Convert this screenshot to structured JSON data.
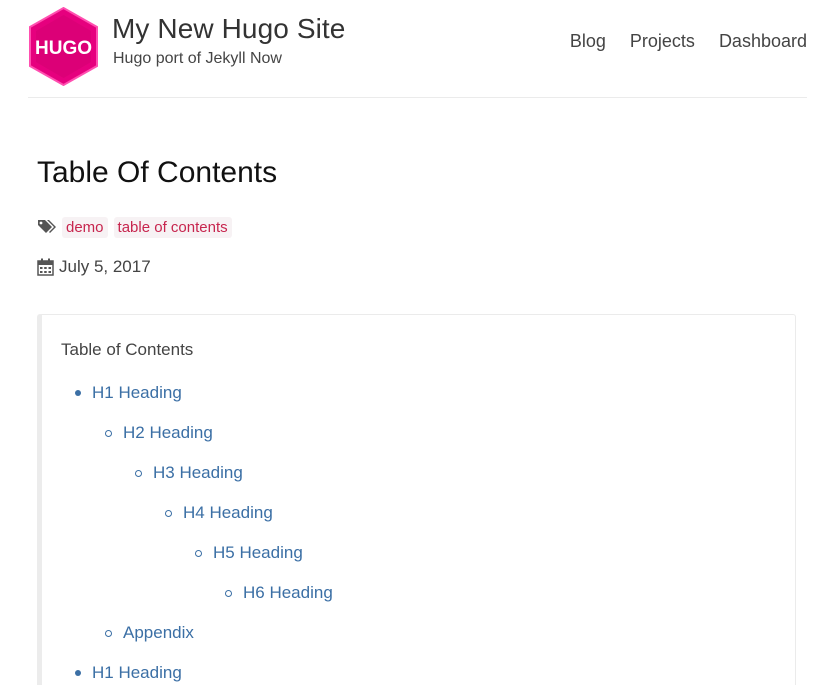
{
  "site": {
    "title": "My New Hugo Site",
    "tagline": "Hugo port of Jekyll Now",
    "logo_text": "HUGO",
    "logo_color": "#e6007e"
  },
  "nav": {
    "items": [
      {
        "label": "Blog"
      },
      {
        "label": "Projects"
      },
      {
        "label": "Dashboard"
      }
    ]
  },
  "post": {
    "title": "Table Of Contents",
    "tags": [
      "demo",
      "table of contents"
    ],
    "date": "July 5, 2017"
  },
  "toc": {
    "heading": "Table of Contents",
    "items": [
      {
        "label": "H1 Heading",
        "level": 1
      },
      {
        "label": "H2 Heading",
        "level": 2
      },
      {
        "label": "H3 Heading",
        "level": 3
      },
      {
        "label": "H4 Heading",
        "level": 4
      },
      {
        "label": "H5 Heading",
        "level": 5
      },
      {
        "label": "H6 Heading",
        "level": 6
      },
      {
        "label": "Appendix",
        "level": 2
      },
      {
        "label": "H1 Heading",
        "level": 1
      }
    ]
  },
  "colors": {
    "link": "#3b6fa5",
    "tag_text": "#c7254e",
    "tag_bg": "#f7f2f4"
  }
}
